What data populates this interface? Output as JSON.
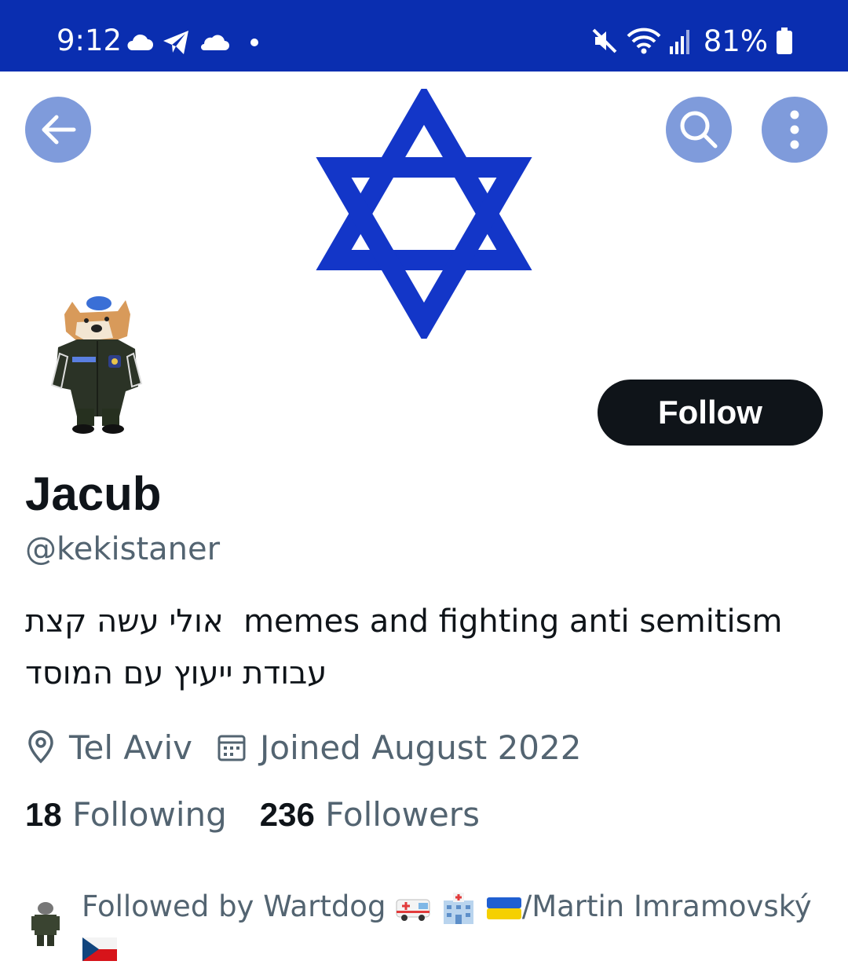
{
  "status_bar": {
    "time": "9:12",
    "battery": "81%",
    "bg_color": "#0a2eb0",
    "left_icons": [
      "cloud-icon",
      "telegram-icon",
      "onedrive-icon",
      "dot-icon"
    ],
    "right_icons": [
      "mute-icon",
      "wifi-icon",
      "signal-icon",
      "battery-icon"
    ]
  },
  "header": {
    "banner_icon": "star-of-david",
    "banner_color": "#1336c8",
    "buttons": [
      "back-arrow-icon",
      "search-icon",
      "more-vertical-icon"
    ],
    "button_color": "#7f9bdb"
  },
  "profile": {
    "follow_label": "Follow",
    "display_name": "Jacub",
    "handle": "@kekistaner",
    "bio_hebrew_1": "אולי עשה קצת",
    "bio_english": "memes and fighting anti semitism",
    "bio_hebrew_2": "עבודת ייעוץ עם המוסד",
    "location": "Tel Aviv",
    "joined": "Joined August 2022",
    "following_count": "18",
    "following_label": "Following",
    "followers_count": "236",
    "followers_label": "Followers",
    "followed_by_text": "Followed by Wartdog",
    "followed_by_suffix": "/Martin Imramovský",
    "followed_by_emojis": [
      "ambulance",
      "hospital",
      "flag-ukraine",
      "flag-czechia"
    ]
  }
}
